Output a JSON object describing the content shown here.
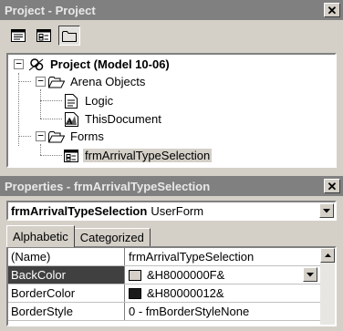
{
  "project_window": {
    "title": "Project - Project",
    "close_glyph": "✕",
    "toolbar": {
      "buttons": [
        {
          "name": "view-code-icon"
        },
        {
          "name": "view-object-icon"
        },
        {
          "name": "toggle-folders-icon"
        }
      ]
    },
    "tree": {
      "root": {
        "label": "Project (Model 10-06)",
        "expander": "−"
      },
      "arena_objects": {
        "label": "Arena Objects",
        "expander": "−"
      },
      "logic": {
        "label": "Logic"
      },
      "this_document": {
        "label": "ThisDocument"
      },
      "forms": {
        "label": "Forms",
        "expander": "−"
      },
      "form_item": {
        "label": "frmArrivalTypeSelection"
      }
    }
  },
  "properties_window": {
    "title": "Properties - frmArrivalTypeSelection",
    "close_glyph": "✕",
    "object_selector": {
      "name": "frmArrivalTypeSelection",
      "type": "UserForm"
    },
    "tabs": [
      {
        "label": "Alphabetic",
        "active": true
      },
      {
        "label": "Categorized",
        "active": false
      }
    ],
    "rows": [
      {
        "name": "(Name)",
        "value": "frmArrivalTypeSelection",
        "swatch": null
      },
      {
        "name": "BackColor",
        "value": "&H8000000F&",
        "swatch": "#d4d0c8"
      },
      {
        "name": "BorderColor",
        "value": "&H80000012&",
        "swatch": "#1a1a1a"
      },
      {
        "name": "BorderStyle",
        "value": "0 - fmBorderStyleNone",
        "swatch": null
      }
    ]
  }
}
